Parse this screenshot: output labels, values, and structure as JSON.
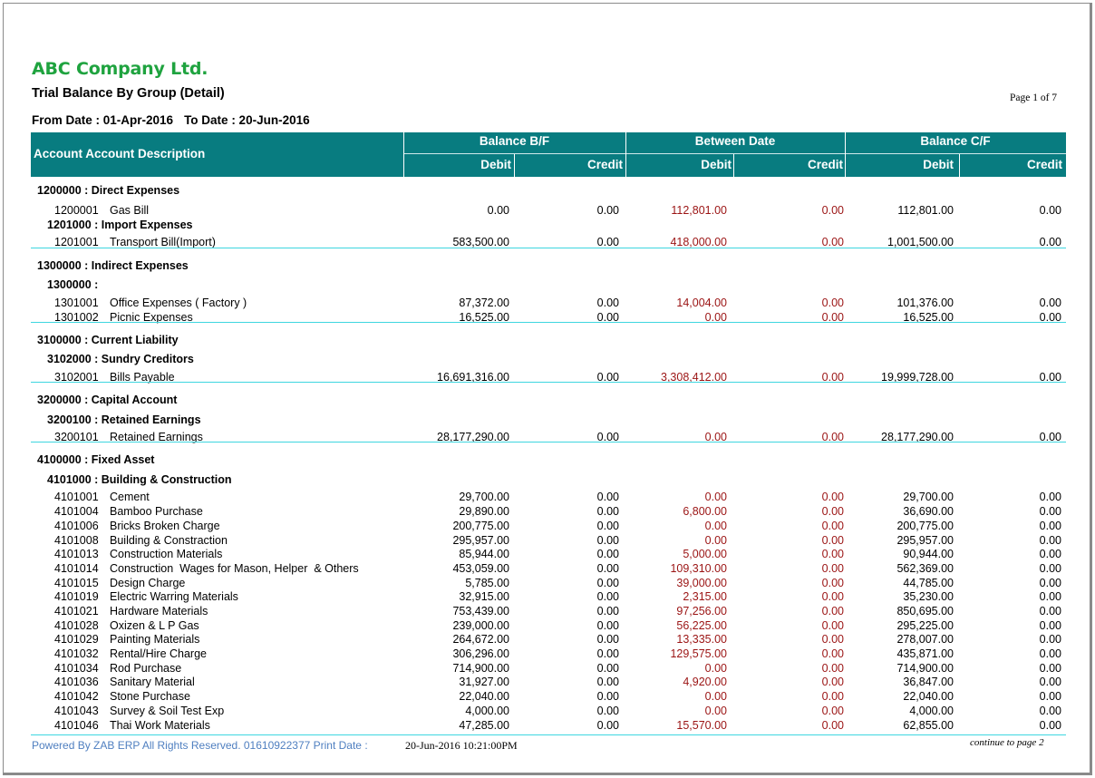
{
  "company": "ABC Company Ltd.",
  "report_title": "Trial Balance By Group (Detail)",
  "page_info": "Page 1 of 7",
  "from_date": "From Date : 01-Apr-2016",
  "to_date": "To Date : 20-Jun-2016",
  "header": {
    "account": "Account  Account Description",
    "groups": [
      "Balance B/F",
      "Between Date",
      "Balance C/F"
    ],
    "debit": "Debit",
    "credit": "Credit"
  },
  "groups": [
    {
      "title": "1200000 : Direct Expenses",
      "subgroups": [
        {
          "title": "",
          "rows": [
            [
              "1200001",
              "Gas Bill",
              "0.00",
              "0.00",
              "112,801.00",
              "0.00",
              "112,801.00",
              "0.00"
            ]
          ]
        },
        {
          "title": "1201000 : Import Expenses",
          "rows": [
            [
              "1201001",
              "Transport Bill(Import)",
              "583,500.00",
              "0.00",
              "418,000.00",
              "0.00",
              "1,001,500.00",
              "0.00"
            ]
          ]
        }
      ]
    },
    {
      "title": "1300000 : Indirect Expenses",
      "subgroups": [
        {
          "title": "1300000 :",
          "rows": [
            [
              "1301001",
              "Office Expenses ( Factory )",
              "87,372.00",
              "0.00",
              "14,004.00",
              "0.00",
              "101,376.00",
              "0.00"
            ],
            [
              "1301002",
              "Picnic Expenses",
              "16,525.00",
              "0.00",
              "0.00",
              "0.00",
              "16,525.00",
              "0.00"
            ]
          ]
        }
      ]
    },
    {
      "title": "3100000 : Current Liability",
      "subgroups": [
        {
          "title": "3102000 : Sundry Creditors",
          "rows": [
            [
              "3102001",
              "Bills Payable",
              "16,691,316.00",
              "0.00",
              "3,308,412.00",
              "0.00",
              "19,999,728.00",
              "0.00"
            ]
          ]
        }
      ]
    },
    {
      "title": "3200000 : Capital Account",
      "subgroups": [
        {
          "title": "3200100 : Retained Earnings",
          "rows": [
            [
              "3200101",
              "Retained Earnings",
              "28,177,290.00",
              "0.00",
              "0.00",
              "0.00",
              "28,177,290.00",
              "0.00"
            ]
          ]
        }
      ]
    },
    {
      "title": "4100000 : Fixed Asset",
      "subgroups": [
        {
          "title": "4101000 : Building & Construction",
          "rows": [
            [
              "4101001",
              "Cement",
              "29,700.00",
              "0.00",
              "0.00",
              "0.00",
              "29,700.00",
              "0.00"
            ],
            [
              "4101004",
              "Bamboo Purchase",
              "29,890.00",
              "0.00",
              "6,800.00",
              "0.00",
              "36,690.00",
              "0.00"
            ],
            [
              "4101006",
              "Bricks Broken Charge",
              "200,775.00",
              "0.00",
              "0.00",
              "0.00",
              "200,775.00",
              "0.00"
            ],
            [
              "4101008",
              "Building & Constraction",
              "295,957.00",
              "0.00",
              "0.00",
              "0.00",
              "295,957.00",
              "0.00"
            ],
            [
              "4101013",
              "Construction Materials",
              "85,944.00",
              "0.00",
              "5,000.00",
              "0.00",
              "90,944.00",
              "0.00"
            ],
            [
              "4101014",
              "Construction  Wages for Mason, Helper  & Others",
              "453,059.00",
              "0.00",
              "109,310.00",
              "0.00",
              "562,369.00",
              "0.00"
            ],
            [
              "4101015",
              "Design Charge",
              "5,785.00",
              "0.00",
              "39,000.00",
              "0.00",
              "44,785.00",
              "0.00"
            ],
            [
              "4101019",
              "Electric Warring Materials",
              "32,915.00",
              "0.00",
              "2,315.00",
              "0.00",
              "35,230.00",
              "0.00"
            ],
            [
              "4101021",
              "Hardware Materials",
              "753,439.00",
              "0.00",
              "97,256.00",
              "0.00",
              "850,695.00",
              "0.00"
            ],
            [
              "4101028",
              "Oxizen & L P Gas",
              "239,000.00",
              "0.00",
              "56,225.00",
              "0.00",
              "295,225.00",
              "0.00"
            ],
            [
              "4101029",
              "Painting Materials",
              "264,672.00",
              "0.00",
              "13,335.00",
              "0.00",
              "278,007.00",
              "0.00"
            ],
            [
              "4101032",
              "Rental/Hire Charge",
              "306,296.00",
              "0.00",
              "129,575.00",
              "0.00",
              "435,871.00",
              "0.00"
            ],
            [
              "4101034",
              "Rod Purchase",
              "714,900.00",
              "0.00",
              "0.00",
              "0.00",
              "714,900.00",
              "0.00"
            ],
            [
              "4101036",
              "Sanitary Material",
              "31,927.00",
              "0.00",
              "4,920.00",
              "0.00",
              "36,847.00",
              "0.00"
            ],
            [
              "4101042",
              "Stone Purchase",
              "22,040.00",
              "0.00",
              "0.00",
              "0.00",
              "22,040.00",
              "0.00"
            ],
            [
              "4101043",
              "Survey & Soil Test Exp",
              "4,000.00",
              "0.00",
              "0.00",
              "0.00",
              "4,000.00",
              "0.00"
            ],
            [
              "4101046",
              "Thai Work Materials",
              "47,285.00",
              "0.00",
              "15,570.00",
              "0.00",
              "62,855.00",
              "0.00"
            ]
          ]
        }
      ]
    }
  ],
  "footer": {
    "powered": "Powered By ZAB ERP  All Rights Reserved. 01610922377  Print Date :",
    "print_date": "20-Jun-2016 10:21:00PM",
    "continue": "continue to page   2"
  },
  "colors": {
    "header_bg": "#087c80",
    "company": "#1fa33f",
    "between_date": "#9b1414",
    "rule": "#3ed6e0",
    "footer": "#4f7fc0"
  }
}
